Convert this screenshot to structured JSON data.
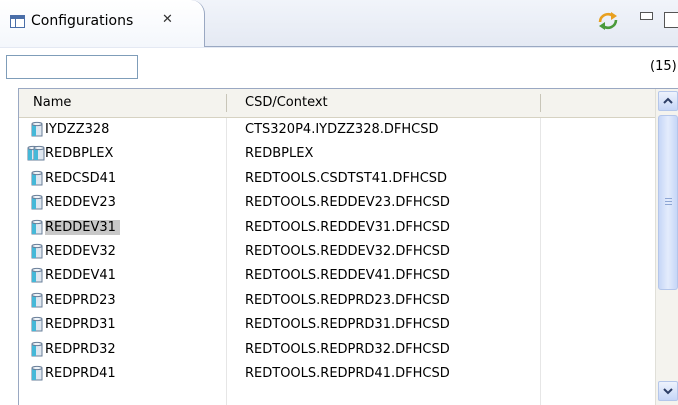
{
  "view": {
    "tab_title": "Configurations",
    "close_glyph": "✕",
    "icons": [
      "table-view-icon",
      "sync-icon",
      "minimize-icon",
      "maximize-icon"
    ]
  },
  "filter": {
    "value": "",
    "placeholder": ""
  },
  "count_label": "(15)",
  "table": {
    "columns": [
      "Name",
      "CSD/Context"
    ],
    "rows": [
      {
        "name": "IYDZZ328",
        "csd": "CTS320P4.IYDZZ328.DFHCSD",
        "icon": "database-icon"
      },
      {
        "name": "REDBPLEX",
        "csd": "REDBPLEX",
        "icon": "multi-database-icon"
      },
      {
        "name": "REDCSD41",
        "csd": "REDTOOLS.CSDTST41.DFHCSD",
        "icon": "database-icon"
      },
      {
        "name": "REDDEV23",
        "csd": "REDTOOLS.REDDEV23.DFHCSD",
        "icon": "database-icon"
      },
      {
        "name": "REDDEV31",
        "csd": "REDTOOLS.REDDEV31.DFHCSD",
        "icon": "database-icon",
        "selected": true
      },
      {
        "name": "REDDEV32",
        "csd": "REDTOOLS.REDDEV32.DFHCSD",
        "icon": "database-icon"
      },
      {
        "name": "REDDEV41",
        "csd": "REDTOOLS.REDDEV41.DFHCSD",
        "icon": "database-icon"
      },
      {
        "name": "REDPRD23",
        "csd": "REDTOOLS.REDPRD23.DFHCSD",
        "icon": "database-icon"
      },
      {
        "name": "REDPRD31",
        "csd": "REDTOOLS.REDPRD31.DFHCSD",
        "icon": "database-icon"
      },
      {
        "name": "REDPRD32",
        "csd": "REDTOOLS.REDPRD32.DFHCSD",
        "icon": "database-icon"
      },
      {
        "name": "REDPRD41",
        "csd": "REDTOOLS.REDPRD41.DFHCSD",
        "icon": "database-icon"
      }
    ]
  },
  "colors": {
    "selection": "#c8c8c8",
    "icon_cyan": "#45b8d8",
    "accent": "#4a6ea8"
  }
}
